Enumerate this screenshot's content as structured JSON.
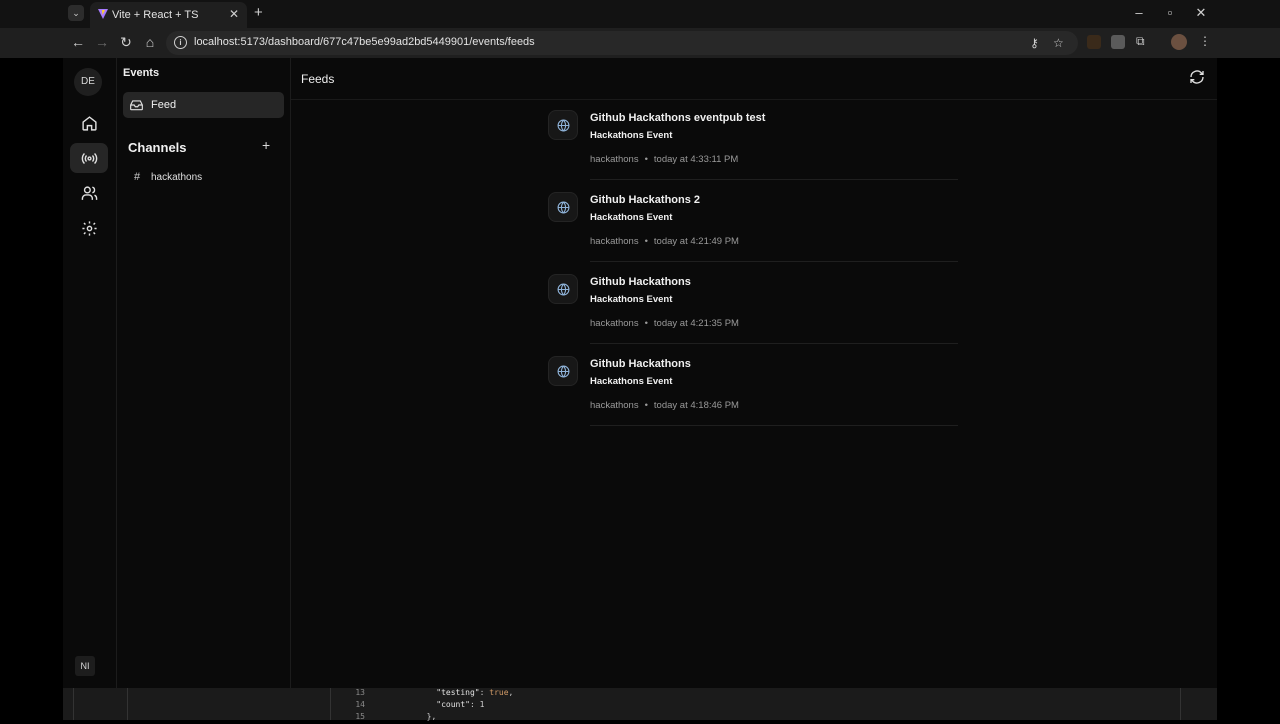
{
  "browser": {
    "tab_title": "Vite + React + TS",
    "url": "localhost:5173/dashboard/677c47be5e99ad2bd5449901/events/feeds",
    "new_tab_symbol": "+",
    "tab_close_symbol": "✕"
  },
  "rail": {
    "workspace_initials": "DE",
    "user_initials": "NI",
    "items": [
      {
        "name": "home",
        "active": false
      },
      {
        "name": "events",
        "active": true
      },
      {
        "name": "users",
        "active": false
      },
      {
        "name": "settings",
        "active": false
      }
    ]
  },
  "sidebar": {
    "title": "Events",
    "feed_label": "Feed",
    "channels_heading": "Channels",
    "add_symbol": "+",
    "channels": [
      {
        "hash": "#",
        "label": "hackathons"
      }
    ]
  },
  "main": {
    "title": "Feeds",
    "feed_items": [
      {
        "title": "Github Hackathons eventpub test",
        "subtitle": "Hackathons Event",
        "channel": "hackathons",
        "dot": "•",
        "time": "today at 4:33:11 PM"
      },
      {
        "title": "Github Hackathons 2",
        "subtitle": "Hackathons Event",
        "channel": "hackathons",
        "dot": "•",
        "time": "today at 4:21:49 PM"
      },
      {
        "title": "Github Hackathons",
        "subtitle": "Hackathons Event",
        "channel": "hackathons",
        "dot": "•",
        "time": "today at 4:21:35 PM"
      },
      {
        "title": "Github Hackathons",
        "subtitle": "Hackathons Event",
        "channel": "hackathons",
        "dot": "•",
        "time": "today at 4:18:46 PM"
      }
    ]
  },
  "devtools": {
    "lines": [
      {
        "num": "13",
        "indent": "    ",
        "key": "\"testing\"",
        "sep": ": ",
        "value": "true",
        "trail": ","
      },
      {
        "num": "14",
        "indent": "    ",
        "key": "\"count\"",
        "sep": ": ",
        "value": "1",
        "trail": ""
      },
      {
        "num": "15",
        "indent": "  ",
        "key": "},",
        "sep": "",
        "value": "",
        "trail": ""
      }
    ]
  },
  "colors": {
    "accent_globe": "#8fb3d9",
    "background": "#0a0a0a",
    "active_item": "#262626"
  }
}
